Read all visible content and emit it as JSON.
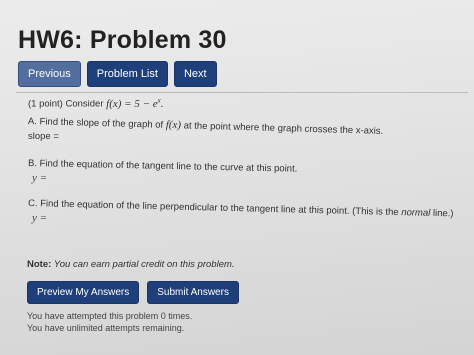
{
  "header": {
    "title": "HW6: Problem 30"
  },
  "nav": {
    "previous": "Previous",
    "problem_list": "Problem List",
    "next": "Next"
  },
  "problem": {
    "points": "(1 point) Consider",
    "function": "f(x) = 5 − e",
    "exponent": "x",
    "part_a": {
      "prompt": "A. Find the slope of the graph of",
      "func": "f(x)",
      "prompt_end": "at the point where the graph crosses the x-axis.",
      "answer_label": "slope ="
    },
    "part_b": {
      "prompt": "B. Find the equation of the tangent line to the curve at this point.",
      "answer_label": "y ="
    },
    "part_c": {
      "prompt": "C. Find the equation of the line perpendicular to the tangent line at this point. (This is the",
      "prompt_em": "normal",
      "prompt_end": "line.)",
      "answer_label": "y ="
    }
  },
  "note": {
    "label": "Note:",
    "text": "You can earn partial credit on this problem."
  },
  "actions": {
    "preview": "Preview My Answers",
    "submit": "Submit Answers"
  },
  "status": {
    "attempts": "You have attempted this problem 0 times.",
    "remaining": "You have unlimited attempts remaining."
  }
}
